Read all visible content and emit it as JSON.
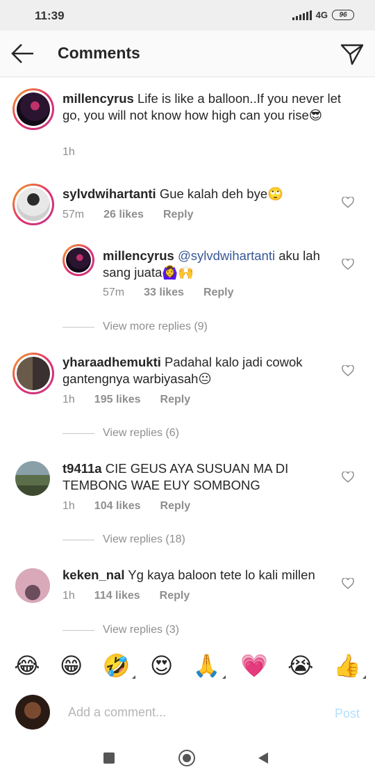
{
  "status_bar": {
    "time": "11:39",
    "network": "4G",
    "battery": "96"
  },
  "header": {
    "title": "Comments"
  },
  "caption": {
    "username": "millencyrus",
    "text": "Life is like a balloon..If you never let go, you will not know how high can you rise😎",
    "time": "1h"
  },
  "comments": [
    {
      "username": "sylvdwihartanti",
      "text": "Gue kalah deh bye🙄",
      "time": "57m",
      "likes": "26 likes",
      "reply": "Reply"
    },
    {
      "username": "millencyrus",
      "mention": "@sylvdwihartanti",
      "text": "aku lah sang juata🙆‍♀️🙌",
      "time": "57m",
      "likes": "33 likes",
      "reply": "Reply"
    },
    {
      "username": "yharaadhemukti",
      "text": "Padahal kalo jadi cowok gantengnya warbiyasah😐",
      "time": "1h",
      "likes": "195 likes",
      "reply": "Reply"
    },
    {
      "username": "t9411a",
      "text": "CIE GEUS AYA SUSUAN MA DI TEMBONG WAE EUY SOMBONG",
      "time": "1h",
      "likes": "104 likes",
      "reply": "Reply"
    },
    {
      "username": "keken_nal",
      "text": "Yg kaya baloon tete lo kali millen",
      "time": "1h",
      "likes": "114 likes",
      "reply": "Reply"
    }
  ],
  "view_replies": [
    "View more replies (9)",
    "View replies (6)",
    "View replies (18)",
    "View replies (3)"
  ],
  "emojis": [
    "😂",
    "😁",
    "🤣",
    "😍",
    "🙏",
    "💗",
    "😭",
    "👍"
  ],
  "composer": {
    "placeholder": "Add a comment...",
    "post_label": "Post"
  },
  "colors": {
    "link": "#385898",
    "meta": "#8e8e8e",
    "post_disabled": "#b2dffc"
  }
}
